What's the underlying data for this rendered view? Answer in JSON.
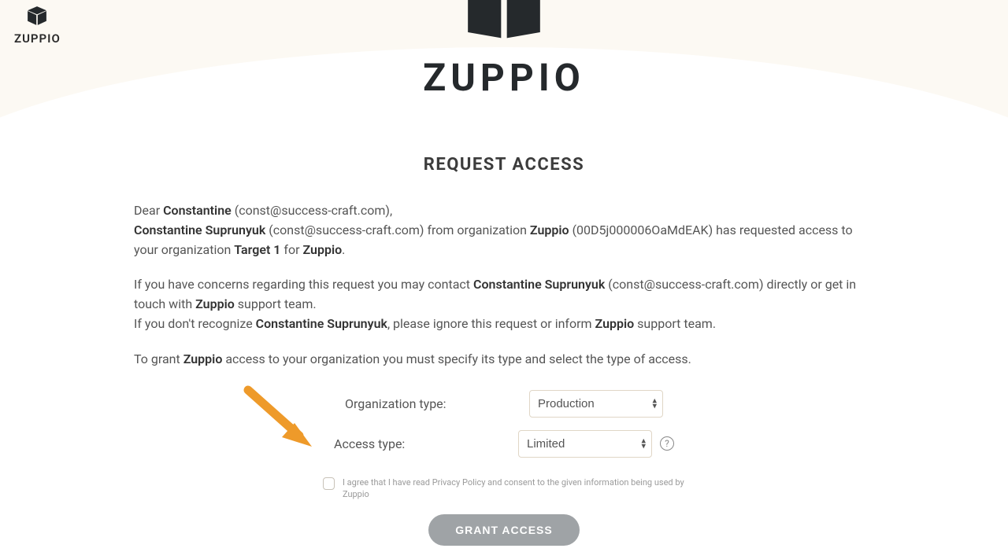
{
  "brand": {
    "name": "ZUPPIO",
    "corner_label": "ZUPPIO"
  },
  "heading": "REQUEST ACCESS",
  "greeting": {
    "dear": "Dear ",
    "name": "Constantine",
    "email_open": " (",
    "email": "const@success-craft.com",
    "email_close": "),"
  },
  "line1": {
    "requester_name": "Constantine Suprunyuk",
    "req_email_open": " (",
    "req_email": "const@success-craft.com",
    "req_email_close": ") from organization ",
    "org_name": "Zuppio",
    "org_id_open": " (",
    "org_id": "00D5j000006OaMdEAK",
    "org_id_close": ") has requested access to your organization ",
    "target_org": "Target 1",
    "for_text": " for ",
    "product": "Zuppio",
    "period": "."
  },
  "line2": {
    "pre": "If you have concerns regarding this request you may contact ",
    "contact_name": "Constantine Suprunyuk",
    "contact_email_open": " (",
    "contact_email": "const@success-craft.com",
    "contact_email_close": ") directly or get in touch with ",
    "team": "Zuppio",
    "suffix": " support team."
  },
  "line3": {
    "pre": "If you don't recognize ",
    "name": "Constantine Suprunyuk",
    "mid": ", please ignore this request or inform ",
    "team": "Zuppio",
    "suffix": " support team."
  },
  "line4": {
    "pre": "To grant ",
    "product": "Zuppio",
    "suffix": " access to your organization you must specify its type and select the type of access."
  },
  "form": {
    "org_type_label": "Organization type:",
    "org_type_value": "Production",
    "access_type_label": "Access type:",
    "access_type_value": "Limited",
    "consent_text": "I agree that I have read Privacy Policy and consent to the given information being used by Zuppio",
    "grant_label": "GRANT ACCESS",
    "help_glyph": "?"
  }
}
